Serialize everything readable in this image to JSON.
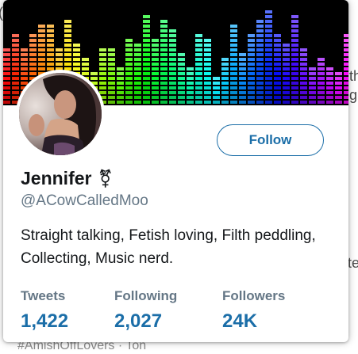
{
  "background_fragments": {
    "right_line1": "th",
    "right_line2": "gu",
    "right_line3": "te",
    "bottom_line": "#AmishOffLovers · Ton",
    "left_line": "(("
  },
  "profile": {
    "display_name": "Jennifer",
    "gender_symbol": "⚧",
    "handle": "@ACowCalledMoo",
    "bio": "Straight talking, Fetish loving, Filth peddling, Collecting, Music nerd.",
    "avatar_icon": "profile-photo",
    "banner_icon": "equalizer-banner"
  },
  "actions": {
    "follow_label": "Follow"
  },
  "stats": [
    {
      "label": "Tweets",
      "value": "1,422"
    },
    {
      "label": "Following",
      "value": "2,027"
    },
    {
      "label": "Followers",
      "value": "24K"
    }
  ],
  "colors": {
    "accent": "#1b6ea8",
    "secondary_text": "#657786",
    "primary_text": "#14171a"
  }
}
